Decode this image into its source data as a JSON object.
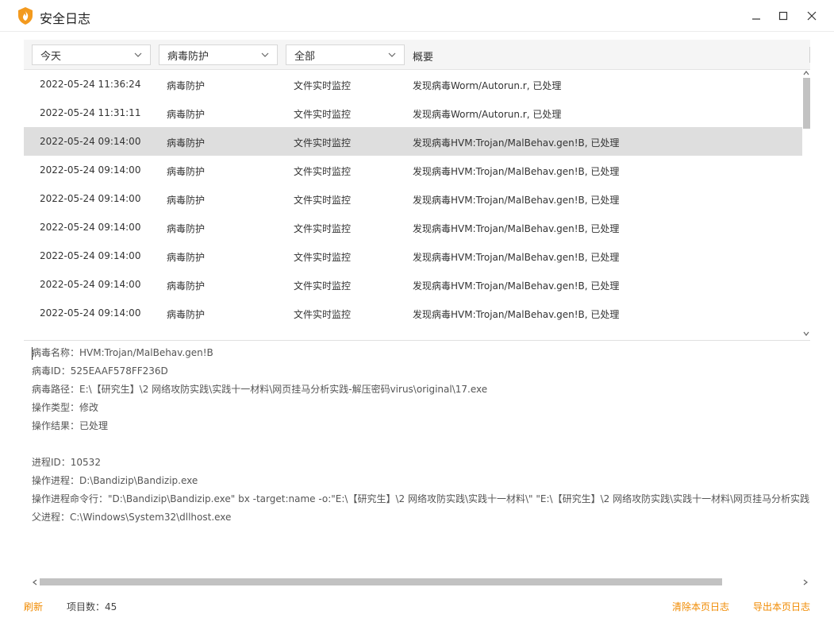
{
  "window": {
    "title": "安全日志"
  },
  "filters": {
    "date": "今天",
    "module": "病毒防护",
    "type": "全部",
    "summary_header": "概要"
  },
  "logs": [
    {
      "time": "2022-05-24 11:36:24",
      "module": "病毒防护",
      "source": "文件实时监控",
      "summary": "发现病毒Worm/Autorun.r, 已处理"
    },
    {
      "time": "2022-05-24 11:31:11",
      "module": "病毒防护",
      "source": "文件实时监控",
      "summary": "发现病毒Worm/Autorun.r, 已处理"
    },
    {
      "time": "2022-05-24 09:14:00",
      "module": "病毒防护",
      "source": "文件实时监控",
      "summary": "发现病毒HVM:Trojan/MalBehav.gen!B, 已处理"
    },
    {
      "time": "2022-05-24 09:14:00",
      "module": "病毒防护",
      "source": "文件实时监控",
      "summary": "发现病毒HVM:Trojan/MalBehav.gen!B, 已处理"
    },
    {
      "time": "2022-05-24 09:14:00",
      "module": "病毒防护",
      "source": "文件实时监控",
      "summary": "发现病毒HVM:Trojan/MalBehav.gen!B, 已处理"
    },
    {
      "time": "2022-05-24 09:14:00",
      "module": "病毒防护",
      "source": "文件实时监控",
      "summary": "发现病毒HVM:Trojan/MalBehav.gen!B, 已处理"
    },
    {
      "time": "2022-05-24 09:14:00",
      "module": "病毒防护",
      "source": "文件实时监控",
      "summary": "发现病毒HVM:Trojan/MalBehav.gen!B, 已处理"
    },
    {
      "time": "2022-05-24 09:14:00",
      "module": "病毒防护",
      "source": "文件实时监控",
      "summary": "发现病毒HVM:Trojan/MalBehav.gen!B, 已处理"
    },
    {
      "time": "2022-05-24 09:14:00",
      "module": "病毒防护",
      "source": "文件实时监控",
      "summary": "发现病毒HVM:Trojan/MalBehav.gen!B, 已处理"
    }
  ],
  "detail": {
    "virus_name": "病毒名称：HVM:Trojan/MalBehav.gen!B",
    "virus_id": "病毒ID：525EAAF578FF236D",
    "virus_path": "病毒路径：E:\\【研究生】\\2 网络攻防实践\\实践十一材料\\网页挂马分析实践-解压密码virus\\original\\17.exe",
    "op_type": "操作类型：修改",
    "op_result": "操作结果：已处理",
    "pid": "进程ID：10532",
    "process": "操作进程：D:\\Bandizip\\Bandizip.exe",
    "cmdline": "操作进程命令行：\"D:\\Bandizip\\Bandizip.exe\"   bx   -target:name -o:\"E:\\【研究生】\\2 网络攻防实践\\实践十一材料\\\"    \"E:\\【研究生】\\2 网络攻防实践\\实践十一材料\\网页挂马分析实践",
    "parent": "父进程：C:\\Windows\\System32\\dllhost.exe"
  },
  "footer": {
    "refresh": "刷新",
    "count": "项目数：45",
    "clear": "清除本页日志",
    "export": "导出本页日志"
  },
  "colors": {
    "accent": "#f08a00",
    "selected_row": "#dedede"
  }
}
